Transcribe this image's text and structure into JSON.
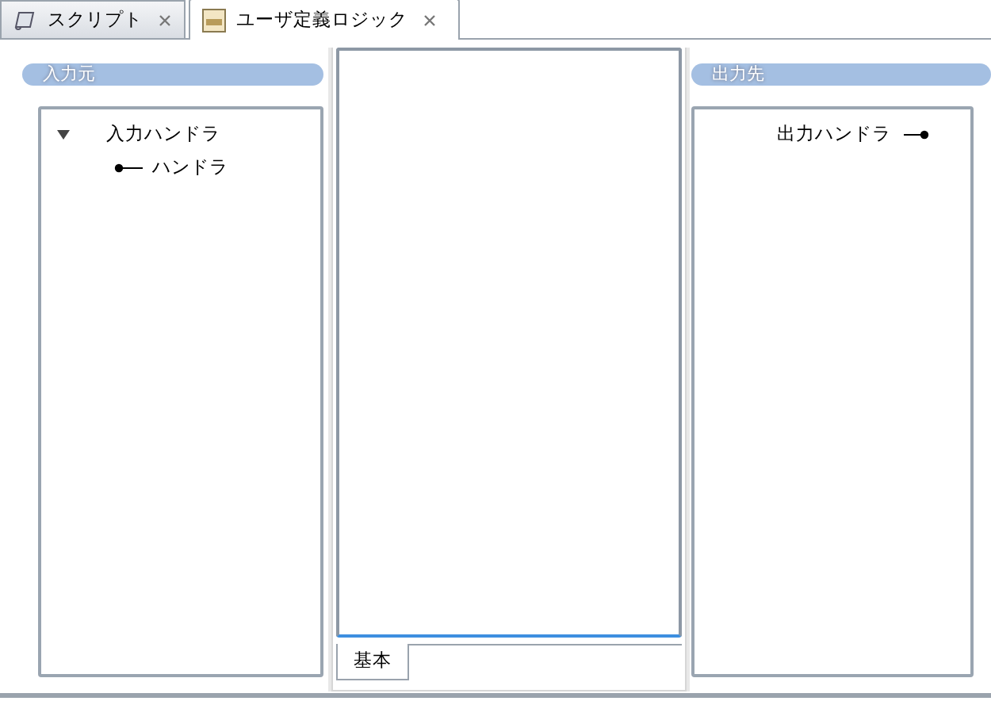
{
  "tabs": [
    {
      "label": "スクリプト",
      "selected": false,
      "kind": "script"
    },
    {
      "label": "ユーザ定義ロジック",
      "selected": true,
      "kind": "logic"
    }
  ],
  "input_panel": {
    "title": "入力元",
    "tree": [
      {
        "label": "入力ハンドラ",
        "expanded": true,
        "children": [
          {
            "label": "ハンドラ"
          }
        ]
      }
    ]
  },
  "editor": {
    "tabs": [
      {
        "label": "基本",
        "selected": true
      }
    ]
  },
  "output_panel": {
    "title": "出力先",
    "items": [
      {
        "label": "出力ハンドラ"
      }
    ]
  }
}
